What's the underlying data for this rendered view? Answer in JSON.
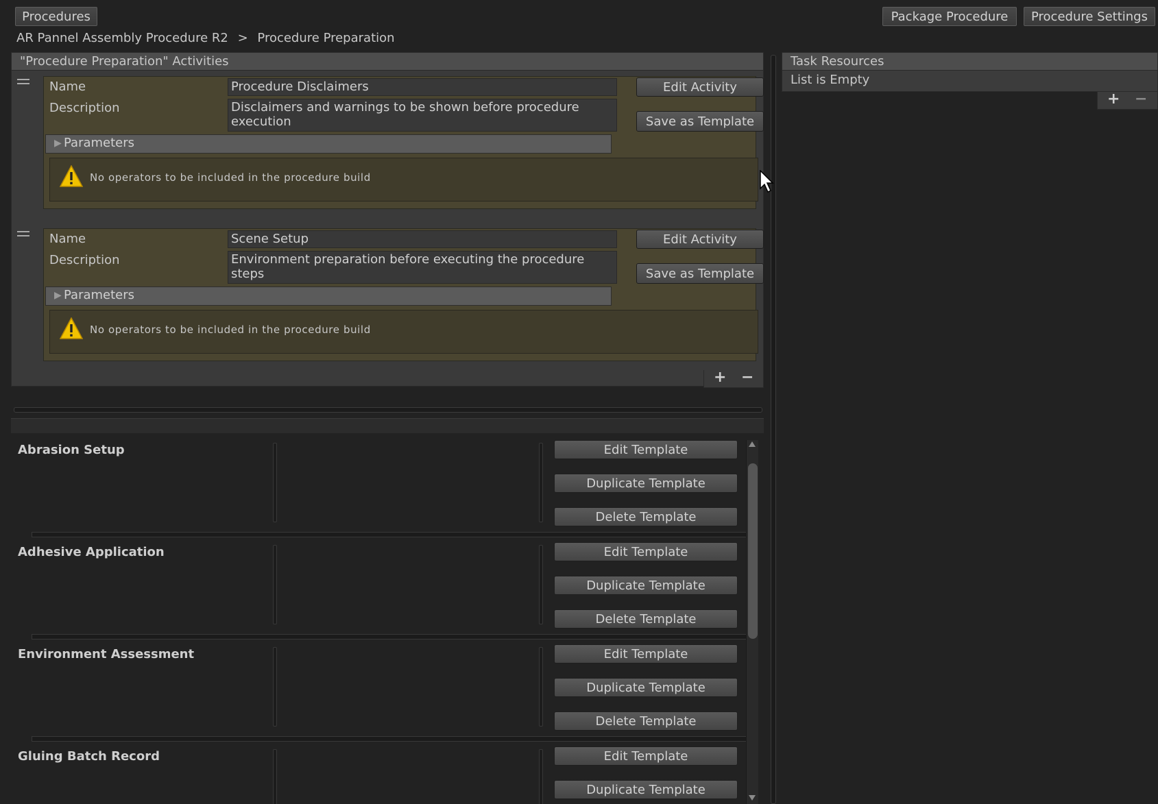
{
  "toolbar": {
    "procedures_label": "Procedures",
    "package_label": "Package Procedure",
    "settings_label": "Procedure Settings"
  },
  "breadcrumb": {
    "root": "AR Pannel Assembly Procedure R2",
    "separator": ">",
    "current": "Procedure Preparation"
  },
  "activities_panel": {
    "header": "\"Procedure Preparation\" Activities",
    "name_label": "Name",
    "description_label": "Description",
    "parameters_label": "Parameters",
    "edit_label": "Edit Activity",
    "save_template_label": "Save as Template",
    "items": [
      {
        "name": "Procedure Disclaimers",
        "description": "Disclaimers and warnings to be shown before procedure execution",
        "warning": "No operators to be included in the procedure build"
      },
      {
        "name": "Scene Setup",
        "description": "Environment preparation before executing the procedure steps",
        "warning": "No operators to be included in the procedure build"
      }
    ],
    "add_symbol": "+",
    "remove_symbol": "−"
  },
  "templates": {
    "edit_label": "Edit Template",
    "duplicate_label": "Duplicate Template",
    "delete_label": "Delete Template",
    "items": [
      {
        "name": "Abrasion Setup"
      },
      {
        "name": "Adhesive Application"
      },
      {
        "name": "Environment Assessment"
      },
      {
        "name": "Gluing Batch Record"
      }
    ]
  },
  "task_resources": {
    "header": "Task Resources",
    "empty_text": "List is Empty",
    "add_symbol": "+",
    "remove_symbol": "−"
  },
  "colors": {
    "background": "#222222",
    "activity_fill": "#4a4530",
    "warning_yellow": "#f2c200"
  }
}
